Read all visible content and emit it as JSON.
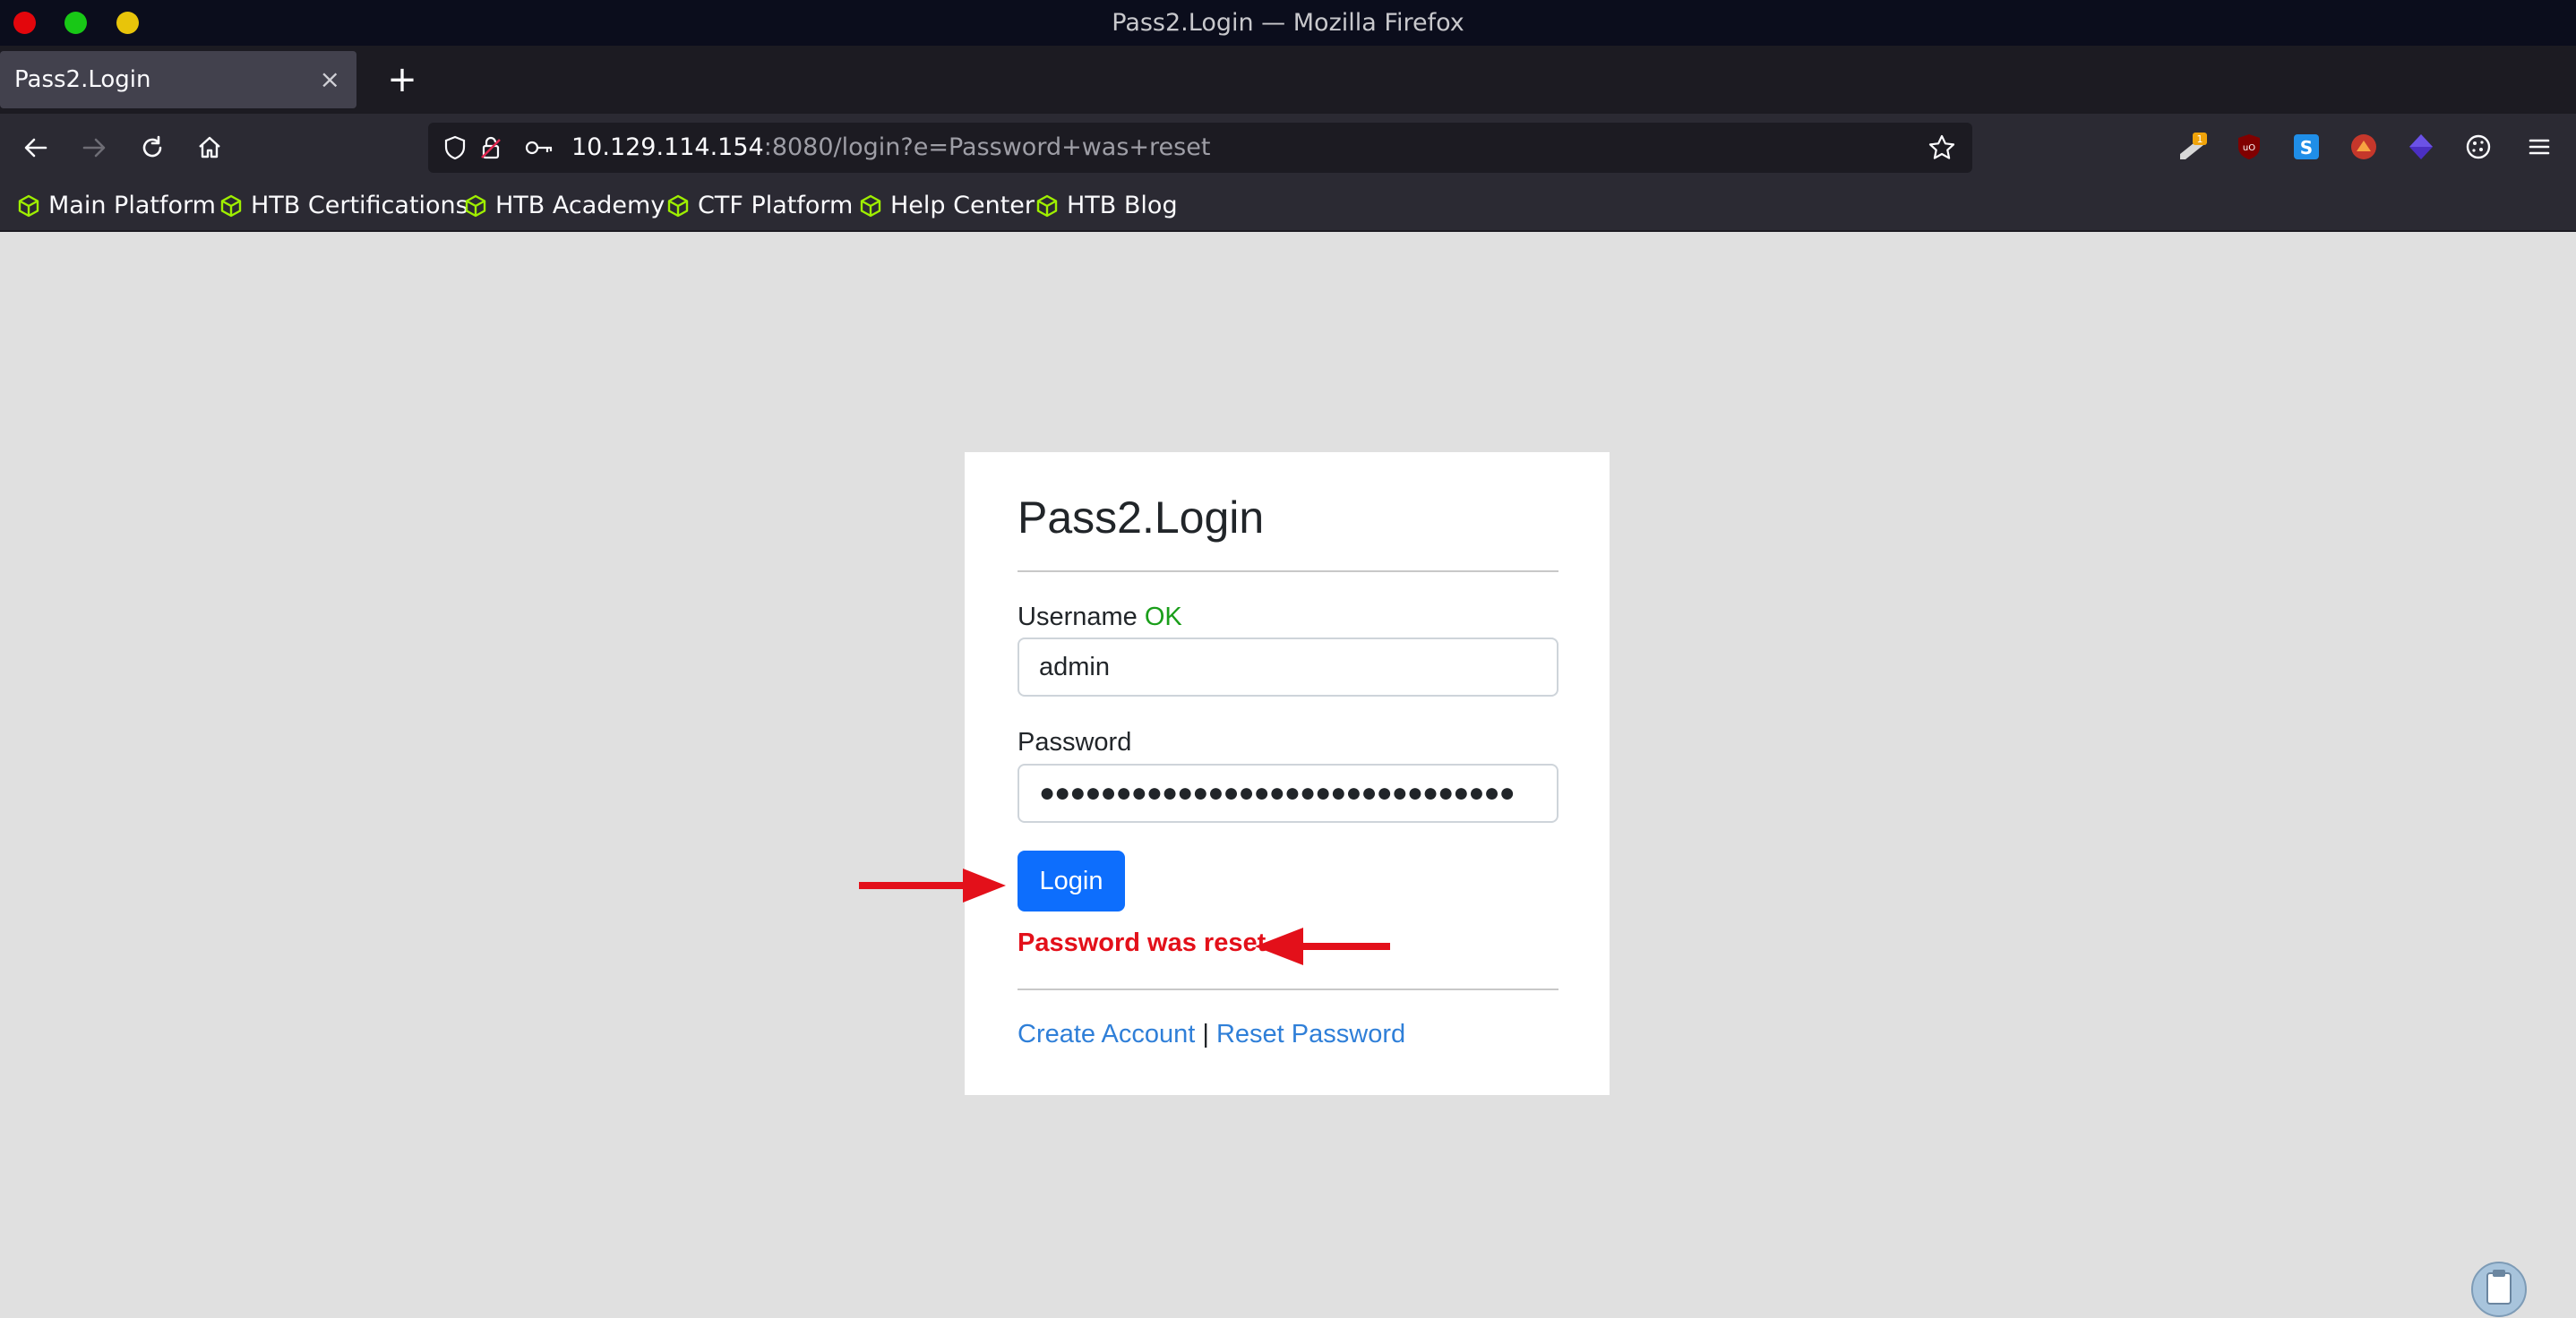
{
  "window": {
    "title": "Pass2.Login — Mozilla Firefox"
  },
  "tabs": [
    {
      "label": "Pass2.Login",
      "close": "×"
    }
  ],
  "new_tab": "+",
  "url": {
    "host": "10.129.114.154",
    "rest": ":8080/login?e=Password+was+reset"
  },
  "bookmarks": [
    "Main Platform",
    "HTB Certifications",
    "HTB Academy",
    "CTF Platform",
    "Help Center",
    "HTB Blog"
  ],
  "extensions": {
    "badge_count": "1",
    "icons": [
      "notes-icon",
      "ublock-icon",
      "s-extension-icon",
      "fox-extension-icon",
      "cube-extension-icon",
      "cookie-icon"
    ]
  },
  "login": {
    "title": "Pass2.Login",
    "username_label": "Username",
    "username_status": "OK",
    "username_value": "admin",
    "password_label": "Password",
    "password_mask": "●●●●●●●●●●●●●●●●●●●●●●●●●●●●●●●",
    "login_button": "Login",
    "error": "Password was reset",
    "create_account": "Create Account",
    "separator": "|",
    "reset_password": "Reset Password"
  },
  "colors": {
    "page_bg": "#e0e0e0",
    "button": "#0d6efd",
    "error": "#e3101a",
    "ok": "#1a9e1a",
    "link": "#2f7fd8",
    "annotation_arrow": "#e3101a"
  }
}
